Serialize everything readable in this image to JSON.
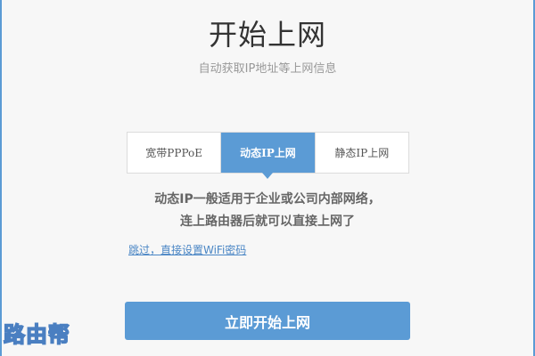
{
  "header": {
    "title": "开始上网",
    "subtitle": "自动获取IP地址等上网信息"
  },
  "tabs": [
    {
      "label": "宽带PPPoE",
      "active": false
    },
    {
      "label": "动态IP上网",
      "active": true
    },
    {
      "label": "静态IP上网",
      "active": false
    }
  ],
  "description": {
    "line1": "动态IP一般适用于企业或公司内部网络，",
    "line2": "连上路由器后就可以直接上网了"
  },
  "skip_link": "跳过，直接设置WiFi密码",
  "start_button": "立即开始上网",
  "watermark": "路由帮",
  "colors": {
    "accent": "#5b9bd5",
    "link": "#4a86c5"
  }
}
